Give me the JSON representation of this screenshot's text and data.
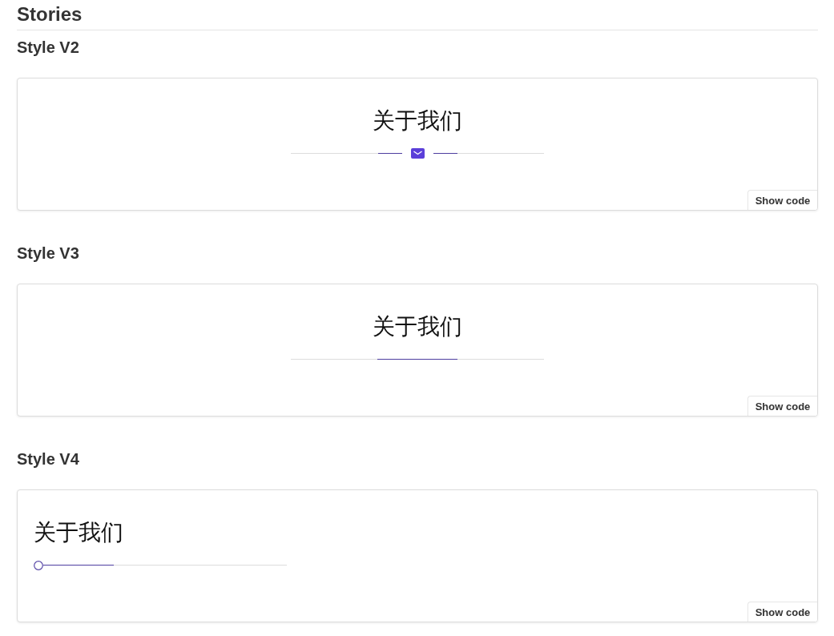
{
  "page": {
    "title": "Stories"
  },
  "stories": [
    {
      "heading": "Style V2",
      "preview": {
        "kind": "icon",
        "title": "关于我们"
      },
      "button": "Show code"
    },
    {
      "heading": "Style V3",
      "preview": {
        "kind": "line",
        "title": "关于我们"
      },
      "button": "Show code"
    },
    {
      "heading": "Style V4",
      "preview": {
        "kind": "dot",
        "title": "关于我们"
      },
      "button": "Show code"
    }
  ]
}
